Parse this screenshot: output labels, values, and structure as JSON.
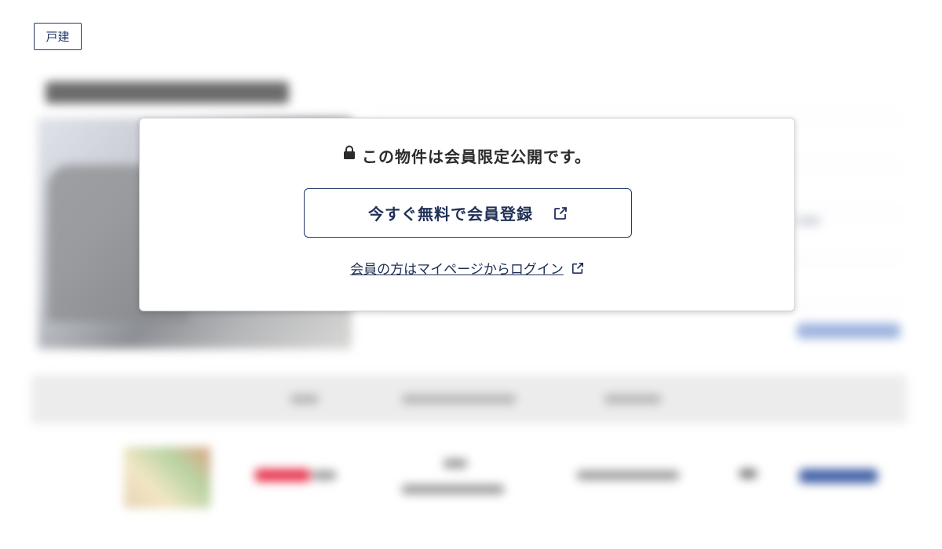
{
  "property_type_tag": "戸建",
  "modal": {
    "message": "この物件は会員限定公開です。",
    "register_button_label": "今すぐ無料で会員登録",
    "login_link_label": "会員の方はマイページからログイン"
  },
  "icons": {
    "lock": "lock-icon",
    "external_link": "external-link-icon"
  },
  "colors": {
    "accent": "#253a6a",
    "text_dark": "#2b2b2b"
  }
}
